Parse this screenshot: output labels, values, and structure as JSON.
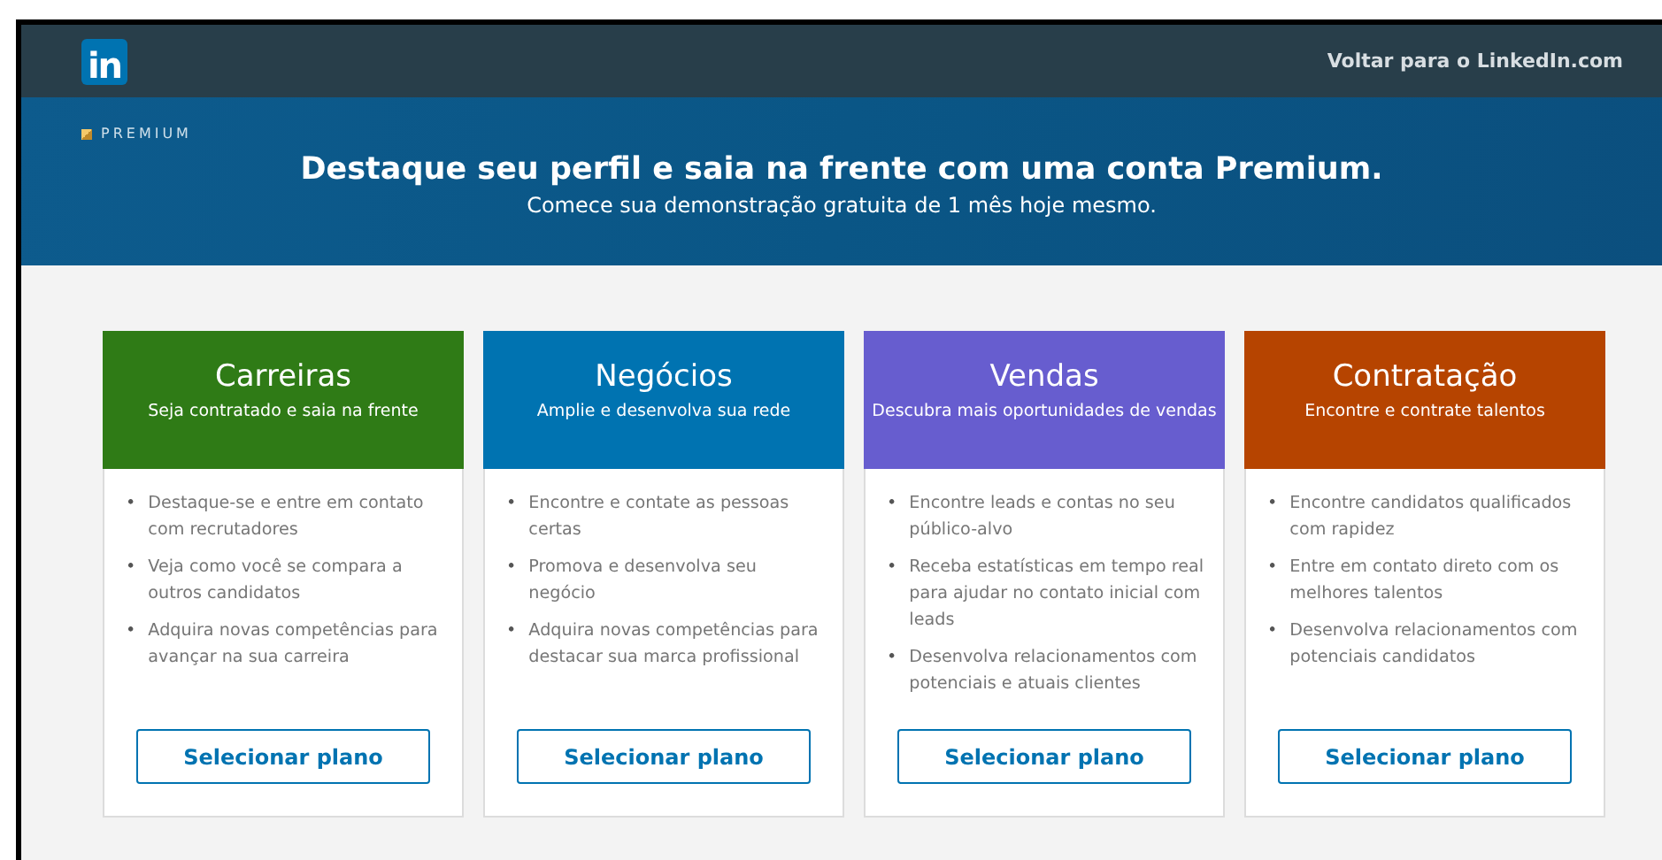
{
  "nav": {
    "logo": "in",
    "link": "Voltar para o LinkedIn.com"
  },
  "banner": {
    "badge": "PREMIUM",
    "title": "Destaque seu perfil e saia na frente com uma conta Premium.",
    "subtitle": "Comece sua demonstração gratuita de 1 mês hoje mesmo."
  },
  "plans": [
    {
      "title": "Carreiras",
      "subtitle": "Seja contratado e saia na frente",
      "color": "#2f7b16",
      "features": [
        {
          "bullet": "•",
          "text": "Destaque-se e entre em contato com recrutadores"
        },
        {
          "bullet": "•",
          "text": "Veja como você se compara a outros candidatos"
        },
        {
          "bullet": "•",
          "text": "Adquira novas competências para avançar na sua carreira"
        }
      ],
      "button": "Selecionar plano"
    },
    {
      "title": "Negócios",
      "subtitle": "Amplie e desenvolva sua rede",
      "color": "#0073b1",
      "features": [
        {
          "bullet": "•",
          "text": "Encontre e contate as pessoas certas"
        },
        {
          "bullet": "•",
          "text": "Promova e desenvolva seu negócio"
        },
        {
          "bullet": "•",
          "text": "Adquira novas competências para destacar sua marca profissional"
        }
      ],
      "button": "Selecionar plano"
    },
    {
      "title": "Vendas",
      "subtitle": "Descubra mais oportunidades de vendas",
      "color": "#675dcf",
      "features": [
        {
          "bullet": "•",
          "text": "Encontre leads e contas no seu público-alvo"
        },
        {
          "bullet": "•",
          "text": "Receba estatísticas em tempo real para ajudar no contato inicial com leads"
        },
        {
          "bullet": "•",
          "text": "Desenvolva relacionamentos com potenciais e atuais clientes"
        }
      ],
      "button": "Selecionar plano"
    },
    {
      "title": "Contratação",
      "subtitle": "Encontre e contrate talentos",
      "color": "#b64400",
      "features": [
        {
          "bullet": "•",
          "text": "Encontre candidatos qualificados com rapidez"
        },
        {
          "bullet": "•",
          "text": "Entre em contato direto com os melhores talentos"
        },
        {
          "bullet": "•",
          "text": "Desenvolva relacionamentos com potenciais candidatos"
        }
      ],
      "button": "Selecionar plano"
    }
  ]
}
